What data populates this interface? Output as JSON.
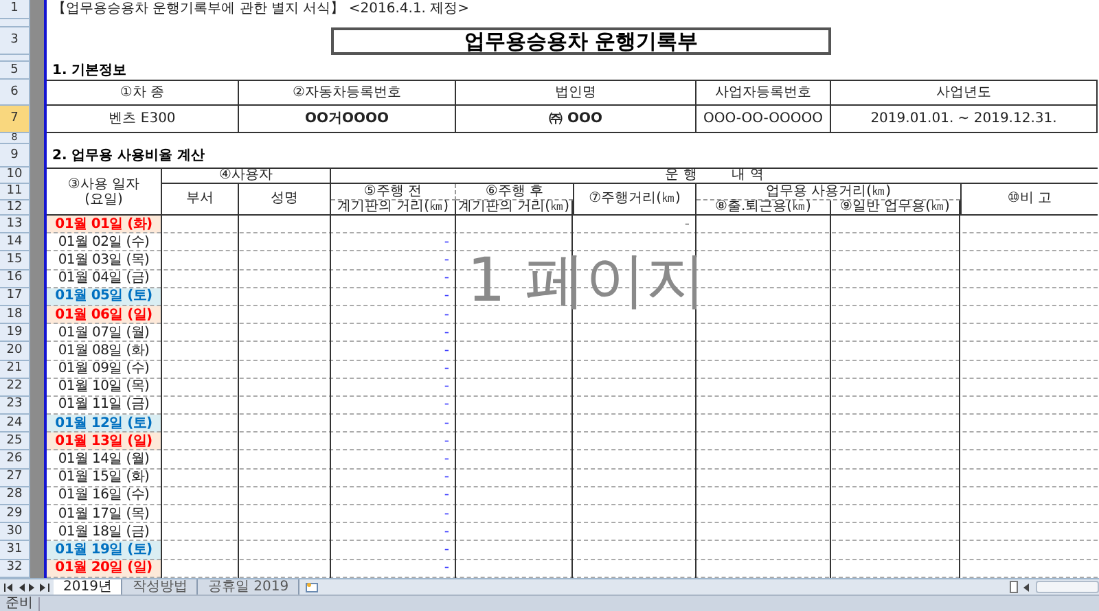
{
  "row_headers": [
    {
      "label": "1",
      "selected": false
    },
    {
      "selected": false
    },
    {
      "label": "3",
      "selected": false
    },
    {
      "selected": false
    },
    {
      "label": "5",
      "selected": false
    },
    {
      "label": "6",
      "selected": false
    },
    {
      "label": "7",
      "selected": true
    },
    {
      "label": "8",
      "selected": false
    },
    {
      "label": "9",
      "selected": false
    },
    {
      "label": "10",
      "selected": false
    },
    {
      "label": "11",
      "selected": false
    },
    {
      "label": "12",
      "selected": false
    },
    {
      "label": "13",
      "selected": false
    },
    {
      "label": "14",
      "selected": false
    },
    {
      "label": "15",
      "selected": false
    },
    {
      "label": "16",
      "selected": false
    },
    {
      "label": "17",
      "selected": false
    },
    {
      "label": "18",
      "selected": false
    },
    {
      "label": "19",
      "selected": false
    },
    {
      "label": "20",
      "selected": false
    },
    {
      "label": "21",
      "selected": false
    },
    {
      "label": "22",
      "selected": false
    },
    {
      "label": "23",
      "selected": false
    },
    {
      "label": "24",
      "selected": false
    },
    {
      "label": "25",
      "selected": false
    },
    {
      "label": "26",
      "selected": false
    },
    {
      "label": "27",
      "selected": false
    },
    {
      "label": "28",
      "selected": false
    },
    {
      "label": "29",
      "selected": false
    },
    {
      "label": "30",
      "selected": false
    },
    {
      "label": "31",
      "selected": false
    },
    {
      "label": "32",
      "selected": false
    }
  ],
  "note": "【업무용승용차 운행기록부에 관한 별지 서식】 <2016.4.1. 제정>",
  "title": "업무용승용차 운행기록부",
  "section_1": {
    "heading": "1. 기본정보",
    "columns": [
      "①차 종",
      "②자동차등록번호",
      "법인명",
      "사업자등록번호",
      "사업년도"
    ],
    "values": [
      "벤츠 E300",
      "OO거OOOO",
      "㈜ OOO",
      "OOO-OO-OOOOO",
      "2019.01.01. ~ 2019.12.31."
    ]
  },
  "section_2": {
    "heading": "2. 업무용 사용비율 계산",
    "headers": {
      "use_date": "③사용 일자 (요일)",
      "user": "④사용자",
      "department": "부서",
      "name": "성명",
      "operation": "운 행        내 역",
      "before": "⑤주행 전",
      "before_sub": "계기판의 거리(㎞)",
      "after": "⑥주행 후",
      "after_sub": "계기판의 거리(㎞)",
      "distance": "⑦주행거리(㎞)",
      "business": "업무용 사용거리(㎞)",
      "commute": "⑧출.퇴근용(㎞)",
      "general": "⑨일반 업무용(㎞)",
      "remarks": "⑩비 고"
    },
    "rows": [
      {
        "date": "01월 01일 (화)",
        "kind": "holiday",
        "distance": "-"
      },
      {
        "date": "01월 02일 (수)",
        "kind": "weekday",
        "before_km": "-"
      },
      {
        "date": "01월 03일 (목)",
        "kind": "weekday",
        "before_km": "-"
      },
      {
        "date": "01월 04일 (금)",
        "kind": "weekday",
        "before_km": "-"
      },
      {
        "date": "01월 05일 (토)",
        "kind": "saturday",
        "before_km": "-"
      },
      {
        "date": "01월 06일 (일)",
        "kind": "holiday",
        "before_km": "-"
      },
      {
        "date": "01월 07일 (월)",
        "kind": "weekday",
        "before_km": "-"
      },
      {
        "date": "01월 08일 (화)",
        "kind": "weekday",
        "before_km": "-"
      },
      {
        "date": "01월 09일 (수)",
        "kind": "weekday",
        "before_km": "-"
      },
      {
        "date": "01월 10일 (목)",
        "kind": "weekday",
        "before_km": "-"
      },
      {
        "date": "01월 11일 (금)",
        "kind": "weekday",
        "before_km": "-"
      },
      {
        "date": "01월 12일 (토)",
        "kind": "saturday",
        "before_km": "-"
      },
      {
        "date": "01월 13일 (일)",
        "kind": "holiday",
        "before_km": "-"
      },
      {
        "date": "01월 14일 (월)",
        "kind": "weekday",
        "before_km": "-"
      },
      {
        "date": "01월 15일 (화)",
        "kind": "weekday",
        "before_km": "-"
      },
      {
        "date": "01월 16일 (수)",
        "kind": "weekday",
        "before_km": "-"
      },
      {
        "date": "01월 17일 (목)",
        "kind": "weekday",
        "before_km": "-"
      },
      {
        "date": "01월 18일 (금)",
        "kind": "weekday",
        "before_km": "-"
      },
      {
        "date": "01월 19일 (토)",
        "kind": "saturday",
        "before_km": "-"
      },
      {
        "date": "01월 20일 (일)",
        "kind": "holiday",
        "before_km": "-"
      }
    ]
  },
  "page_overlay": "1 페이지",
  "sheet_tabs": [
    {
      "label": "2019년",
      "selected": true
    },
    {
      "label": "작성방법",
      "selected": false
    },
    {
      "label": "공휴일 2019",
      "selected": false
    }
  ],
  "status_bar": "준비"
}
